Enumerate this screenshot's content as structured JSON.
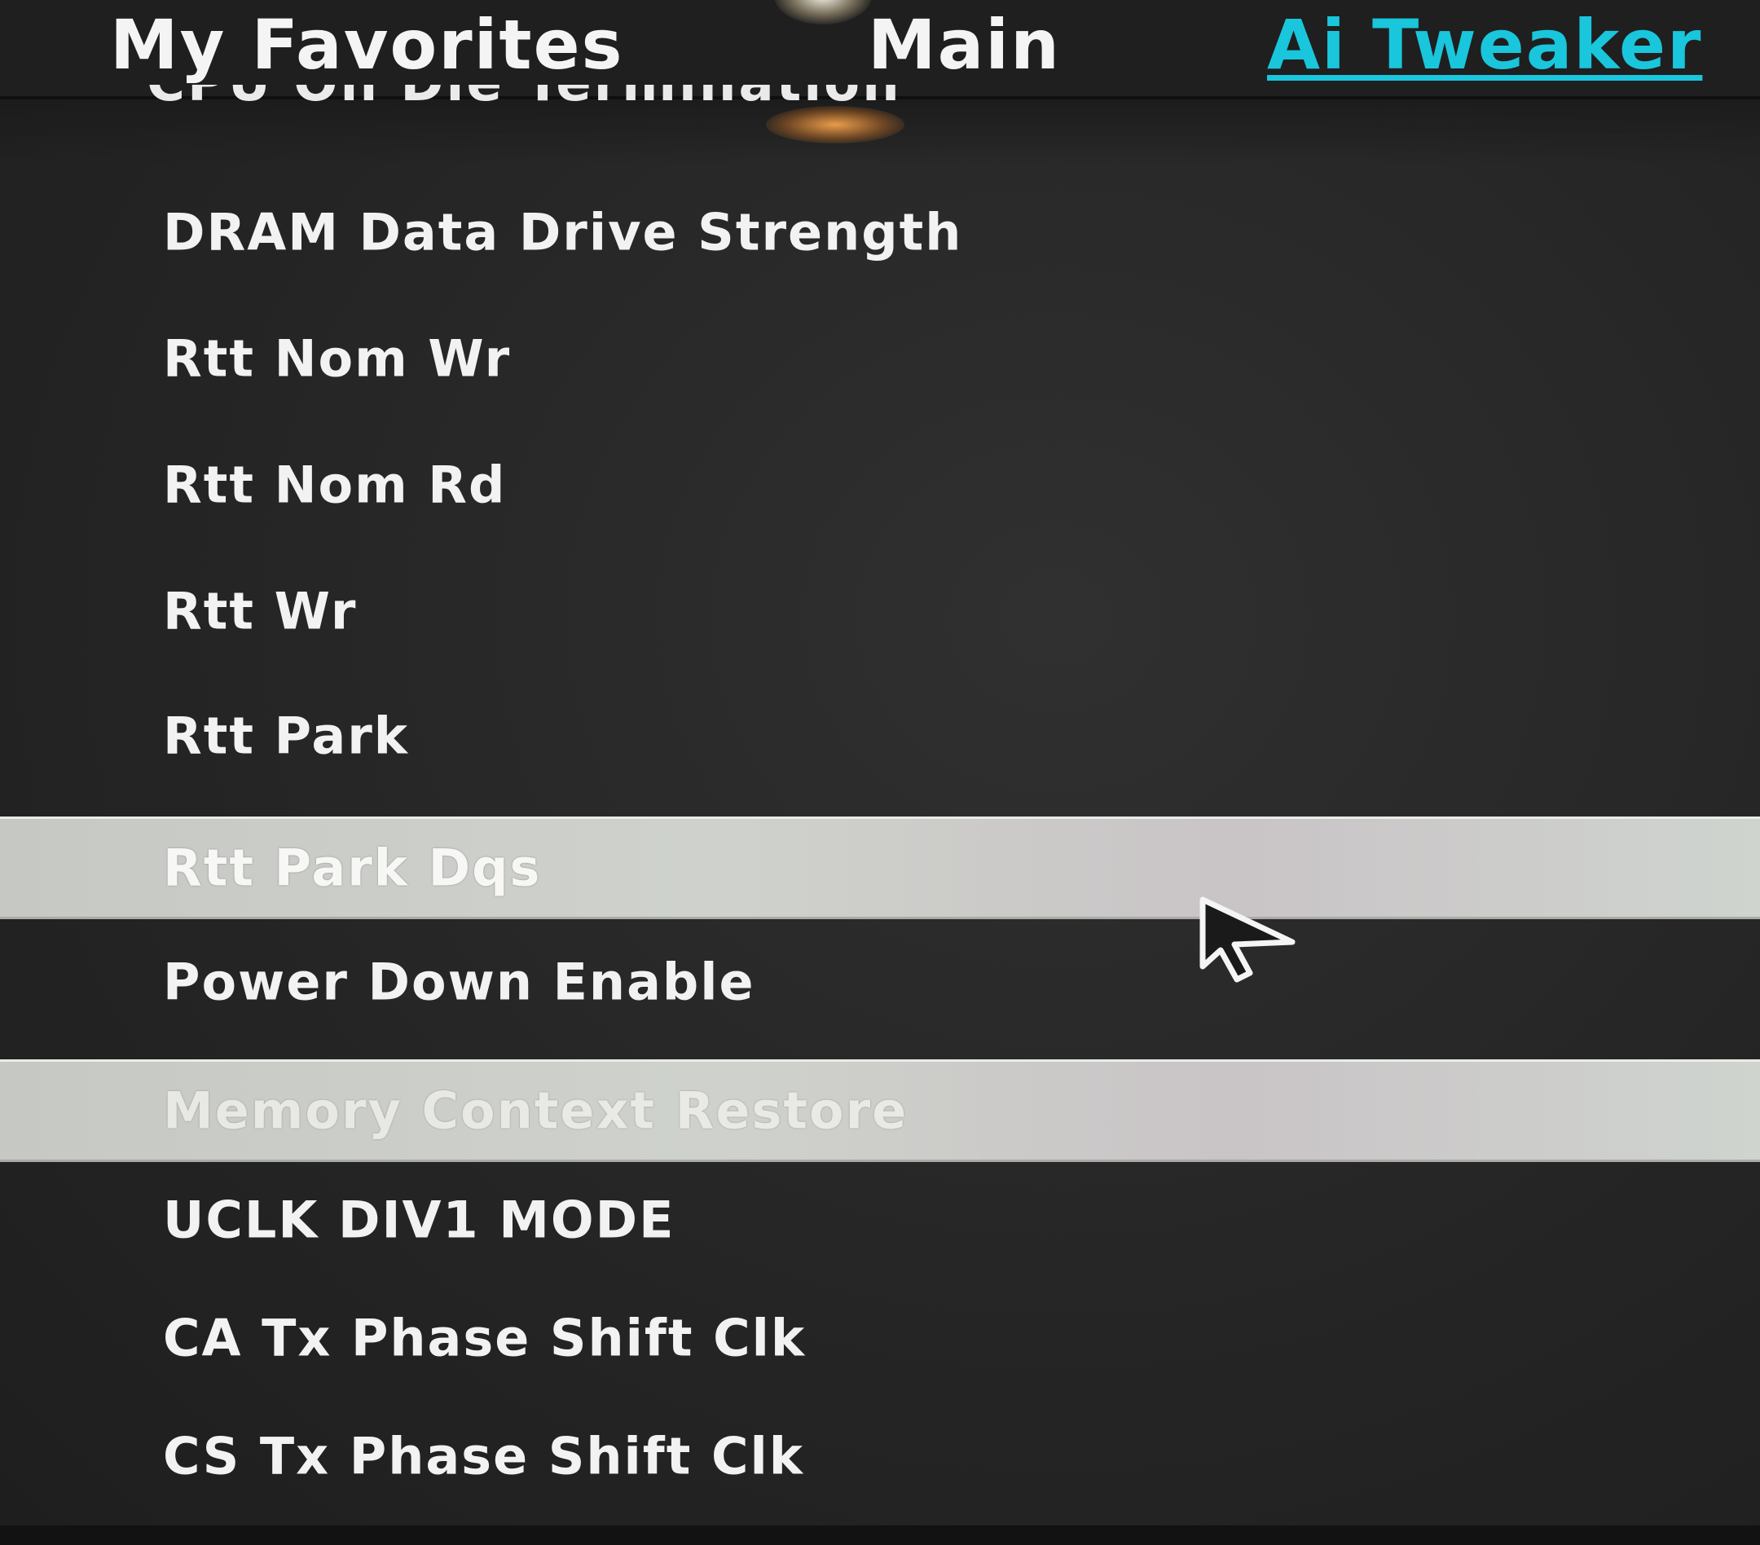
{
  "tabs": [
    {
      "label": "My Favorites",
      "active": false
    },
    {
      "label": "Main",
      "active": false
    },
    {
      "label": "Ai Tweaker",
      "active": true
    }
  ],
  "accent_color": "#19c6dc",
  "highlight_color": "#cfd2cc",
  "cutoff_item": {
    "label": "CPU On Die Termination"
  },
  "menu": {
    "items": [
      {
        "label": "DRAM Data Drive Strength"
      },
      {
        "label": "Rtt Nom Wr"
      },
      {
        "label": "Rtt Nom Rd"
      },
      {
        "label": "Rtt Wr"
      },
      {
        "label": "Rtt Park"
      },
      {
        "label": "Rtt Park Dqs",
        "highlighted": true
      },
      {
        "label": "Power Down Enable"
      },
      {
        "label": "Memory Context Restore",
        "highlighted": true
      },
      {
        "label": "UCLK DIV1 MODE"
      },
      {
        "label": "CA Tx Phase Shift Clk"
      },
      {
        "label": "CS Tx Phase Shift Clk"
      }
    ]
  },
  "cursor_icon": "arrow-pointer-icon"
}
